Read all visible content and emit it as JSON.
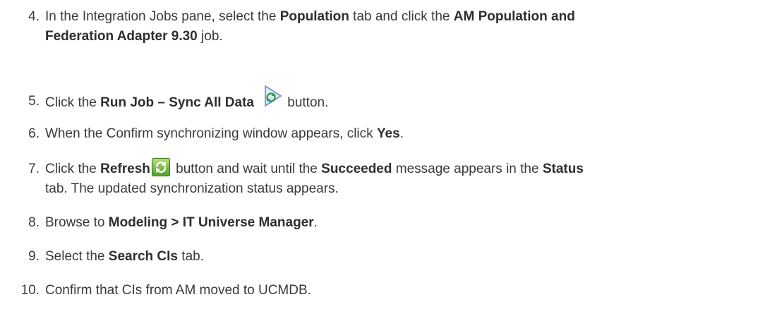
{
  "steps": [
    {
      "number": "4.",
      "parts": {
        "a": "In the Integration Jobs pane, select the ",
        "b": "Population",
        "c": " tab and click the ",
        "d": "AM Population and",
        "e": "Federation Adapter 9.30",
        "f": " job."
      }
    },
    {
      "number": "5.",
      "parts": {
        "a": "Click the ",
        "b": "Run Job – Sync All Data",
        "c": "button.",
        "icon": "run-job-sync-icon"
      }
    },
    {
      "number": "6.",
      "parts": {
        "a": "When the Confirm synchronizing window appears, click ",
        "b": "Yes",
        "c": "."
      }
    },
    {
      "number": "7.",
      "parts": {
        "a": "Click the ",
        "b": "Refresh",
        "c": " button and wait until the ",
        "d": "Succeeded",
        "e": " message appears in the ",
        "f": "Status",
        "g": "tab. The updated synchronization status appears.",
        "icon": "refresh-icon"
      }
    },
    {
      "number": "8.",
      "parts": {
        "a": "Browse to ",
        "b": "Modeling > IT Universe Manager",
        "c": "."
      }
    },
    {
      "number": "9.",
      "parts": {
        "a": "Select the ",
        "b": "Search CIs",
        "c": " tab."
      }
    },
    {
      "number": "10.",
      "parts": {
        "a": "Confirm that CIs from AM moved to UCMDB."
      }
    }
  ]
}
